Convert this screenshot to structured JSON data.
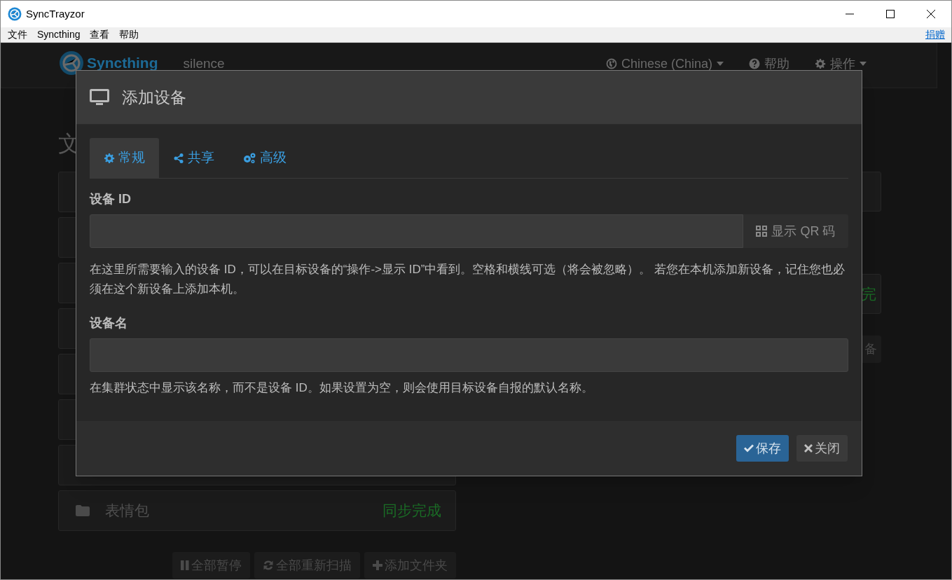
{
  "window": {
    "title": "SyncTrayzor"
  },
  "menu": [
    {
      "label": "文件"
    },
    {
      "label": "Syncthing"
    },
    {
      "label": "查看"
    },
    {
      "label": "帮助"
    }
  ],
  "donate_link": "捐赠",
  "navbar": {
    "brand": "Syncthing",
    "device_name": "silence",
    "items": [
      {
        "kind": "language",
        "label": "Chinese (China)"
      },
      {
        "kind": "help",
        "label": "帮助"
      },
      {
        "kind": "actions",
        "label": "操作"
      }
    ]
  },
  "folders": {
    "heading": "文",
    "items": [
      {
        "name": "表情包",
        "status": "同步完成"
      }
    ]
  },
  "right_column": {
    "status_fragment": "完",
    "button_fragment": "备"
  },
  "global_buttons": [
    {
      "kind": "pause",
      "label": "全部暂停"
    },
    {
      "kind": "rescan",
      "label": "全部重新扫描"
    },
    {
      "kind": "add",
      "label": "添加文件夹"
    }
  ],
  "dialog": {
    "title": "添加设备",
    "tabs": [
      {
        "kind": "general",
        "label": "常规",
        "selected": true
      },
      {
        "kind": "share",
        "label": "共享",
        "selected": false
      },
      {
        "kind": "advanced",
        "label": "高级",
        "selected": false
      }
    ],
    "device_id": {
      "label": "设备 ID",
      "qr_button": "显示 QR 码",
      "help": "在这里所需要输入的设备 ID，可以在目标设备的“操作->显示 ID”中看到。空格和横线可选（将会被忽略）。 若您在本机添加新设备，记住您也必须在这个新设备上添加本机。"
    },
    "device_name": {
      "label": "设备名",
      "help": "在集群状态中显示该名称，而不是设备 ID。如果设置为空，则会使用目标设备自报的默认名称。"
    },
    "buttons": [
      {
        "kind": "save",
        "label": "保存"
      },
      {
        "kind": "close",
        "label": "关闭"
      }
    ]
  }
}
